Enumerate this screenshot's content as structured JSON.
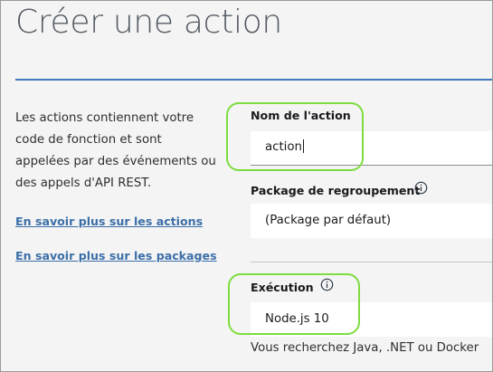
{
  "page": {
    "title": "Créer une action"
  },
  "intro": {
    "lines": [
      "Les actions contiennent votre",
      "code de fonction et sont",
      "appelées par des événements ou",
      "des appels d'API REST."
    ]
  },
  "links": {
    "actions": "En savoir plus sur les actions",
    "packages": "En savoir plus sur les packages"
  },
  "form": {
    "name": {
      "label": "Nom de l'action",
      "value": "action"
    },
    "package": {
      "label": "Package de regroupement",
      "value": "(Package par défaut)",
      "icon": "info-icon"
    },
    "runtime": {
      "label": "Exécution",
      "value": "Node.js 10",
      "icon": "info-icon"
    },
    "runtime_hint": "Vous recherchez Java, .NET ou Docker"
  },
  "colors": {
    "highlight": "#7ddc3f",
    "link": "#3c6fa8",
    "divider": "#4178be"
  }
}
